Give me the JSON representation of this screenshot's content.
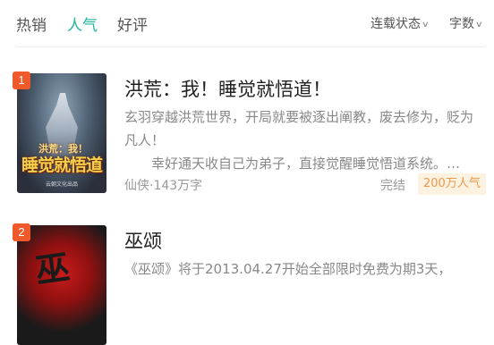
{
  "tabs": [
    {
      "label": "热销",
      "active": false
    },
    {
      "label": "人气",
      "active": true
    },
    {
      "label": "好评",
      "active": false
    }
  ],
  "filters": {
    "status_label": "连载状态",
    "wordcount_label": "字数"
  },
  "colors": {
    "accent": "#1fb5a1",
    "rank_badge": "#f05a2a",
    "popularity_bg": "#fdf1e0",
    "popularity_text": "#e89a4a"
  },
  "books": [
    {
      "rank": "1",
      "title": "洪荒：我！睡觉就悟道！",
      "desc_line1": "玄羽穿越洪荒世界，开局就要被逐出阐教，废去修为，贬为凡人！",
      "desc_line2": "幸好通天收自己为弟子，直接觉醒睡觉悟道系统。…",
      "meta": "仙侠·143万字",
      "status": "完结",
      "popularity": "200万人气",
      "cover_text_top": "洪荒：我！",
      "cover_text_main": "睡觉就悟道",
      "cover_publisher": "云朝文化出品"
    },
    {
      "rank": "2",
      "title": "巫颂",
      "desc_line1": "《巫颂》将于2013.04.27开始全部限时免费为期3天，"
    }
  ]
}
